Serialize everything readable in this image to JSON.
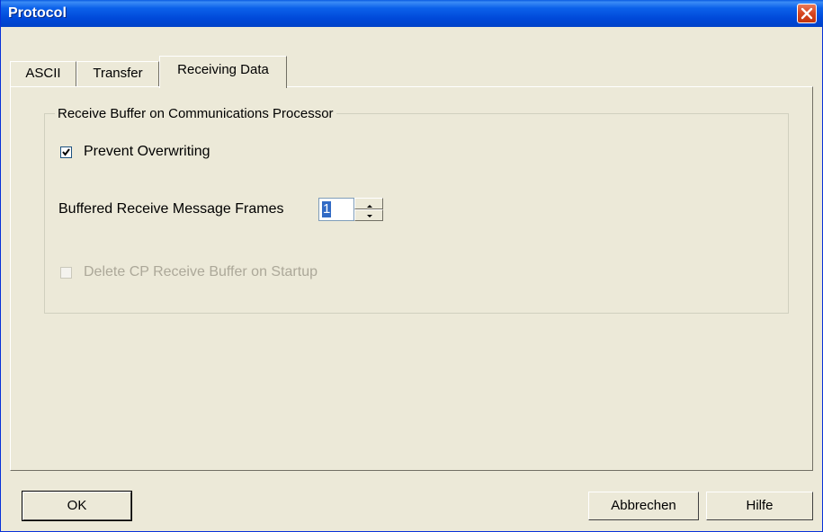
{
  "window": {
    "title": "Protocol"
  },
  "tabs": [
    {
      "label": "ASCII"
    },
    {
      "label": "Transfer"
    },
    {
      "label": "Receiving Data"
    }
  ],
  "group": {
    "title": "Receive Buffer on Communications Processor",
    "prevent_overwriting": {
      "label": "Prevent Overwriting",
      "checked": true
    },
    "buffered_frames": {
      "label": "Buffered Receive Message Frames",
      "value": "1"
    },
    "delete_buffer": {
      "label": "Delete CP Receive Buffer on Startup",
      "checked": false,
      "enabled": false
    }
  },
  "buttons": {
    "ok": "OK",
    "cancel": "Abbrechen",
    "help": "Hilfe"
  }
}
